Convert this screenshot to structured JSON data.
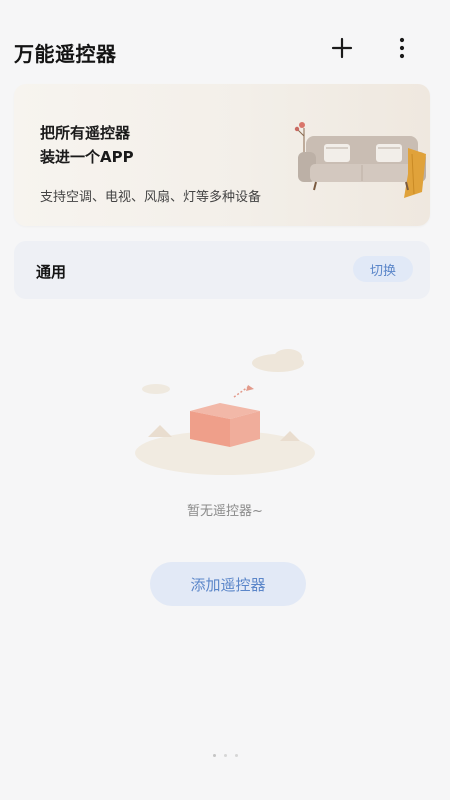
{
  "header": {
    "title": "万能遥控器",
    "add_icon": "plus-icon",
    "more_icon": "more-vertical-icon"
  },
  "banner": {
    "line1": "把所有遥控器",
    "line2": "装进一个APP",
    "subtitle": "支持空调、电视、风扇、灯等多种设备",
    "illustration": "sofa-illustration"
  },
  "general": {
    "label": "通用",
    "switch_label": "切换"
  },
  "empty_state": {
    "illustration": "empty-box-illustration",
    "message": "暂无遥控器~"
  },
  "actions": {
    "add_remote_label": "添加遥控器"
  },
  "colors": {
    "background": "#f6f6f7",
    "accent_text": "#5b86c9",
    "accent_bg": "#e2e9f6",
    "card_bg": "#eef0f5"
  }
}
